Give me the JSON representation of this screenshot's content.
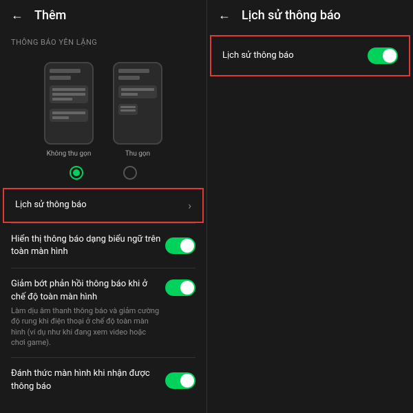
{
  "left": {
    "header": {
      "back_label": "←",
      "title": "Thêm"
    },
    "section_label": "THÔNG BÁO YÊN LẶNG",
    "phone_option_1": {
      "label": "Không thu gọn",
      "selected": true
    },
    "phone_option_2": {
      "label": "Thu gọn",
      "selected": false
    },
    "items": [
      {
        "id": "lich-su-thong-bao",
        "text": "Lịch sử thông báo",
        "has_chevron": true,
        "has_toggle": false,
        "highlighted": true
      },
      {
        "id": "hien-thi-thong-bao",
        "text": "Hiển thị thông báo dạng biểu ngữ trên toàn màn hình",
        "sub": "",
        "has_toggle": true,
        "toggle_on": true,
        "highlighted": false
      },
      {
        "id": "giam-bot-phan-hoi",
        "text": "Giảm bớt phản hồi thông báo khi ở chế độ toàn màn hình",
        "sub": "Làm dịu âm thanh thông báo và giảm cường độ rung khi điện thoại ở chế độ toàn màn hình (ví dụ như khi đang xem video hoặc chơi game).",
        "has_toggle": true,
        "toggle_on": true,
        "highlighted": false
      },
      {
        "id": "danh-thuc-man-hinh",
        "text": "Đánh thức màn hình khi nhận được thông báo",
        "sub": "",
        "has_toggle": true,
        "toggle_on": true,
        "highlighted": false
      }
    ]
  },
  "right": {
    "header": {
      "back_label": "←",
      "title": "Lịch sử thông báo"
    },
    "item": {
      "text": "Lịch sử thông báo",
      "toggle_on": true
    }
  }
}
